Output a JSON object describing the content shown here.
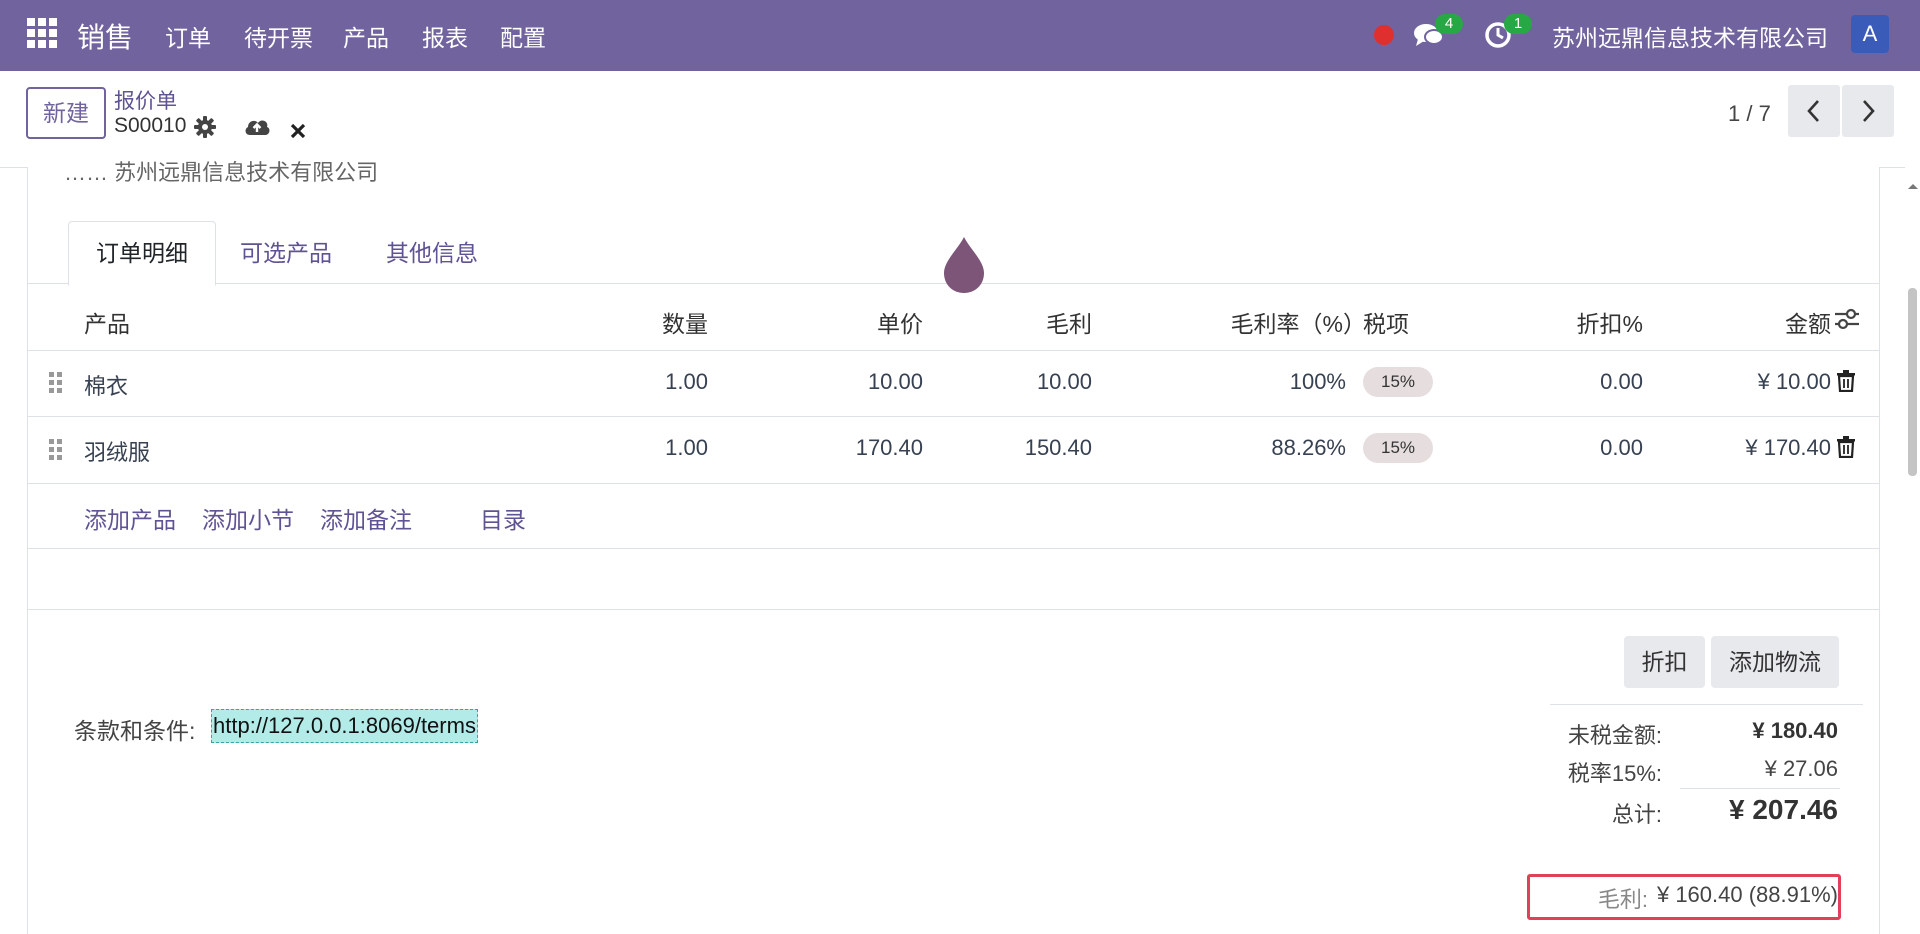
{
  "navbar": {
    "brand": "销售",
    "menu": [
      "订单",
      "待开票",
      "产品",
      "报表",
      "配置"
    ],
    "chat_count": "4",
    "activity_count": "1",
    "company": "苏州远鼎信息技术有限公司",
    "avatar_initial": "A",
    "bg_color": "#71639e"
  },
  "control": {
    "new_button": "新建",
    "breadcrumb_parent": "报价单",
    "record_name": "S00010",
    "pager": "1 / 7"
  },
  "form": {
    "partial_header_text": "…… 苏州远鼎信息技术有限公司",
    "tabs": [
      "订单明细",
      "可选产品",
      "其他信息"
    ],
    "columns": {
      "product": "产品",
      "qty": "数量",
      "price": "单价",
      "margin": "毛利",
      "margin_pct": "毛利率（%）",
      "taxes": "税项",
      "discount": "折扣%",
      "amount": "金额"
    },
    "lines": [
      {
        "product": "棉衣",
        "qty": "1.00",
        "price": "10.00",
        "margin": "10.00",
        "margin_pct": "100%",
        "tax": "15%",
        "discount": "0.00",
        "amount": "¥ 10.00"
      },
      {
        "product": "羽绒服",
        "qty": "1.00",
        "price": "170.40",
        "margin": "150.40",
        "margin_pct": "88.26%",
        "tax": "15%",
        "discount": "0.00",
        "amount": "¥ 170.40"
      }
    ],
    "add_links": [
      "添加产品",
      "添加小节",
      "添加备注",
      "目录"
    ],
    "buttons": {
      "discount": "折扣",
      "add_shipping": "添加物流"
    },
    "terms_label": "条款和条件:",
    "terms_value": "http://127.0.0.1:8069/terms",
    "totals": {
      "untaxed_label": "未税金额:",
      "untaxed_value": "¥ 180.40",
      "tax_label": "税率15%:",
      "tax_value": "¥ 27.06",
      "total_label": "总计:",
      "total_value": "¥ 207.46",
      "margin_label": "毛利:",
      "margin_value": "¥ 160.40 (88.91%)"
    }
  }
}
